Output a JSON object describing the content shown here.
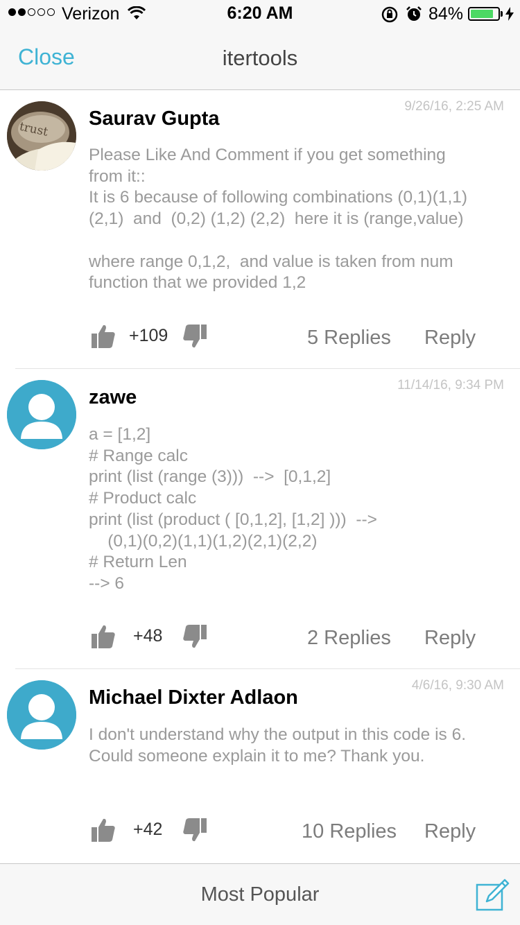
{
  "status_bar": {
    "carrier": "Verizon",
    "time": "6:20 AM",
    "battery_percent": "84%",
    "battery_level": 0.84,
    "signal_strength": 2,
    "icons": [
      "wifi-icon",
      "rotation-lock-icon",
      "alarm-icon",
      "battery-icon",
      "charging-icon"
    ]
  },
  "nav": {
    "close_label": "Close",
    "title": "itertools"
  },
  "comments": [
    {
      "author": "Saurav Gupta",
      "timestamp": "9/26/16, 2:25 AM",
      "avatar": "photo-avatar",
      "avatar_text": "trust",
      "body": "Please Like And Comment if you get something\nfrom it::\nIt is 6 because of following combinations (0,1)(1,1)\n(2,1)  and  (0,2) (1,2) (2,2)  here it is (range,value)\n\nwhere range 0,1,2,  and value is taken from num\nfunction that we provided 1,2",
      "votes": "+109",
      "replies": "5 Replies",
      "reply_label": "Reply"
    },
    {
      "author": "zawe",
      "timestamp": "11/14/16, 9:34 PM",
      "avatar": "default-user-avatar",
      "body": "a = [1,2]\n# Range calc\nprint (list (range (3)))  -->  [0,1,2]\n# Product calc\nprint (list (product ( [0,1,2], [1,2] )))  -->\n    (0,1)(0,2)(1,1)(1,2)(2,1)(2,2)\n# Return Len\n--> 6",
      "votes": "+48",
      "replies": "2 Replies",
      "reply_label": "Reply"
    },
    {
      "author": "Michael Dixter Adlaon",
      "timestamp": "4/6/16, 9:30 AM",
      "avatar": "default-user-avatar",
      "body": "I don't understand why the output in this code is 6.\nCould someone explain it to me? Thank you.",
      "votes": "+42",
      "replies": "10 Replies",
      "reply_label": "Reply"
    }
  ],
  "bottom_bar": {
    "sort_label": "Most Popular",
    "compose_icon": "compose-icon"
  },
  "colors": {
    "accent": "#3fb3d4",
    "avatar_bg": "#3eaacb",
    "battery_fill": "#4cd964",
    "body_text": "#9a9a9a",
    "meta_text": "#c4c4c4"
  }
}
